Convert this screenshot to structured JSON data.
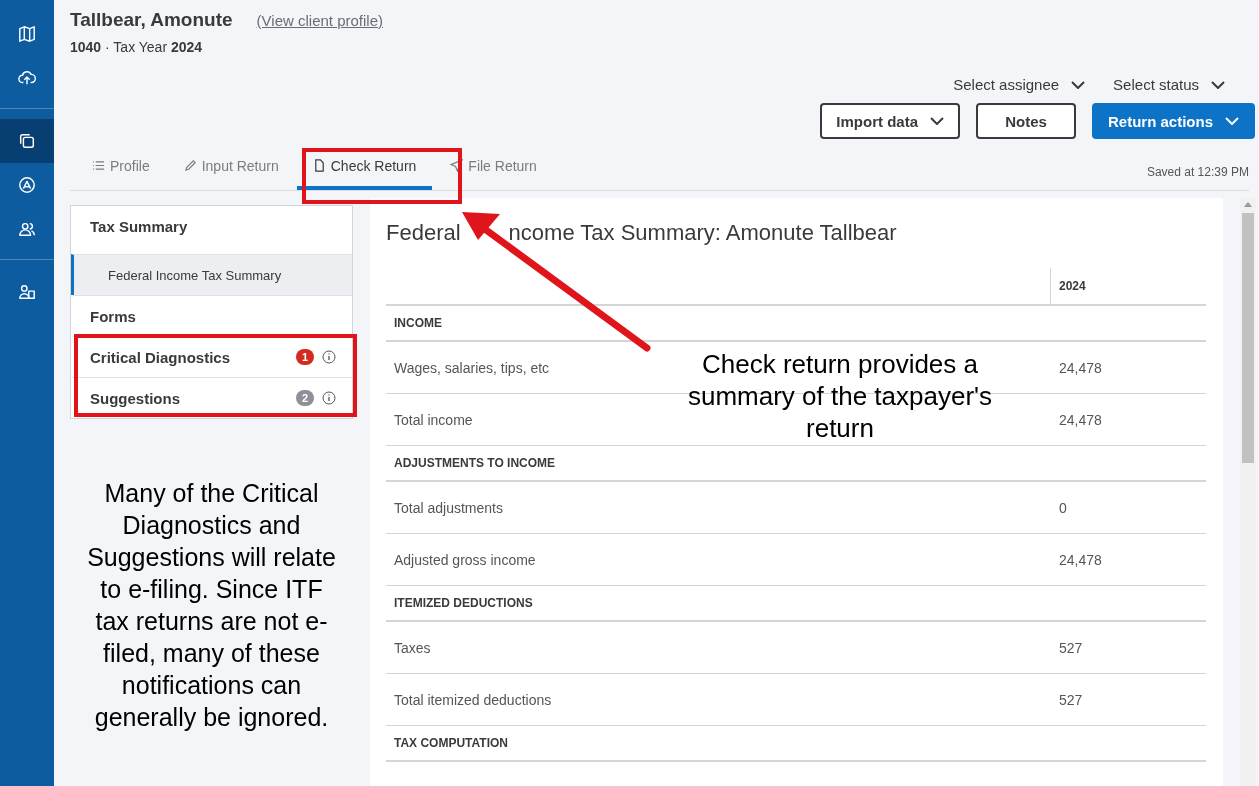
{
  "nav": {
    "groups": [
      [
        {
          "selected": false
        },
        {
          "selected": false
        }
      ],
      [
        {
          "selected": true
        },
        {
          "selected": false
        },
        {
          "selected": false
        }
      ],
      [
        {
          "selected": false
        }
      ]
    ]
  },
  "client": {
    "name": "Tallbear, Amonute",
    "profile_link": "(View client profile)",
    "form": "1040",
    "separator": "·",
    "year_label": "Tax Year",
    "year": "2024"
  },
  "selectors": [
    {
      "label": "Select assignee"
    },
    {
      "label": "Select status"
    }
  ],
  "buttons": [
    {
      "label": "Import data",
      "kind": "dropdown"
    },
    {
      "label": "Notes",
      "kind": "plain"
    },
    {
      "label": "Return actions",
      "kind": "primary"
    }
  ],
  "tabs": [
    {
      "label": "Profile",
      "selected": false
    },
    {
      "label": "Input Return",
      "selected": false
    },
    {
      "label": "Check Return",
      "selected": true
    },
    {
      "label": "File Return",
      "selected": false
    }
  ],
  "saved": "Saved at 12:39 PM",
  "side_panel": {
    "items": [
      {
        "label": "Tax Summary",
        "kind": "heading",
        "selected": false
      },
      {
        "label": "Federal Income Tax Summary",
        "kind": "sub",
        "selected": true
      },
      {
        "label": "Forms",
        "kind": "heading",
        "selected": false
      },
      {
        "label": "Critical Diagnostics",
        "kind": "heading",
        "selected": false,
        "count": "1",
        "color": "#d52b1e"
      },
      {
        "label": "Suggestions",
        "kind": "heading",
        "selected": false,
        "count": "2",
        "color": "#8d9096"
      }
    ]
  },
  "summary": {
    "title_parts": [
      "Federal",
      "ncome Tax Summary: Amonute Tallbear"
    ],
    "column": "2024",
    "rows": [
      {
        "kind": "section",
        "label": "INCOME"
      },
      {
        "kind": "item",
        "label": "Wages, salaries, tips, etc",
        "value": "24,478"
      },
      {
        "kind": "item",
        "label": "Total income",
        "value": "24,478"
      },
      {
        "kind": "section",
        "label": "ADJUSTMENTS TO INCOME"
      },
      {
        "kind": "item",
        "label": "Total adjustments",
        "value": "0"
      },
      {
        "kind": "item",
        "label": "Adjusted gross income",
        "value": "24,478"
      },
      {
        "kind": "section",
        "label": "ITEMIZED DEDUCTIONS"
      },
      {
        "kind": "item",
        "label": "Taxes",
        "value": "527"
      },
      {
        "kind": "item",
        "label": "Total itemized deductions",
        "value": "527"
      },
      {
        "kind": "section",
        "label": "TAX COMPUTATION"
      }
    ]
  },
  "annotations": [
    {
      "kind": "note",
      "text": "Check return provides a summary of the taxpayer's return"
    },
    {
      "kind": "note",
      "text": "Many of the Critical Diagnostics and Suggestions will relate to e-filing. Since ITF tax returns are not e-filed, many of these notifications can generally be ignored."
    }
  ]
}
